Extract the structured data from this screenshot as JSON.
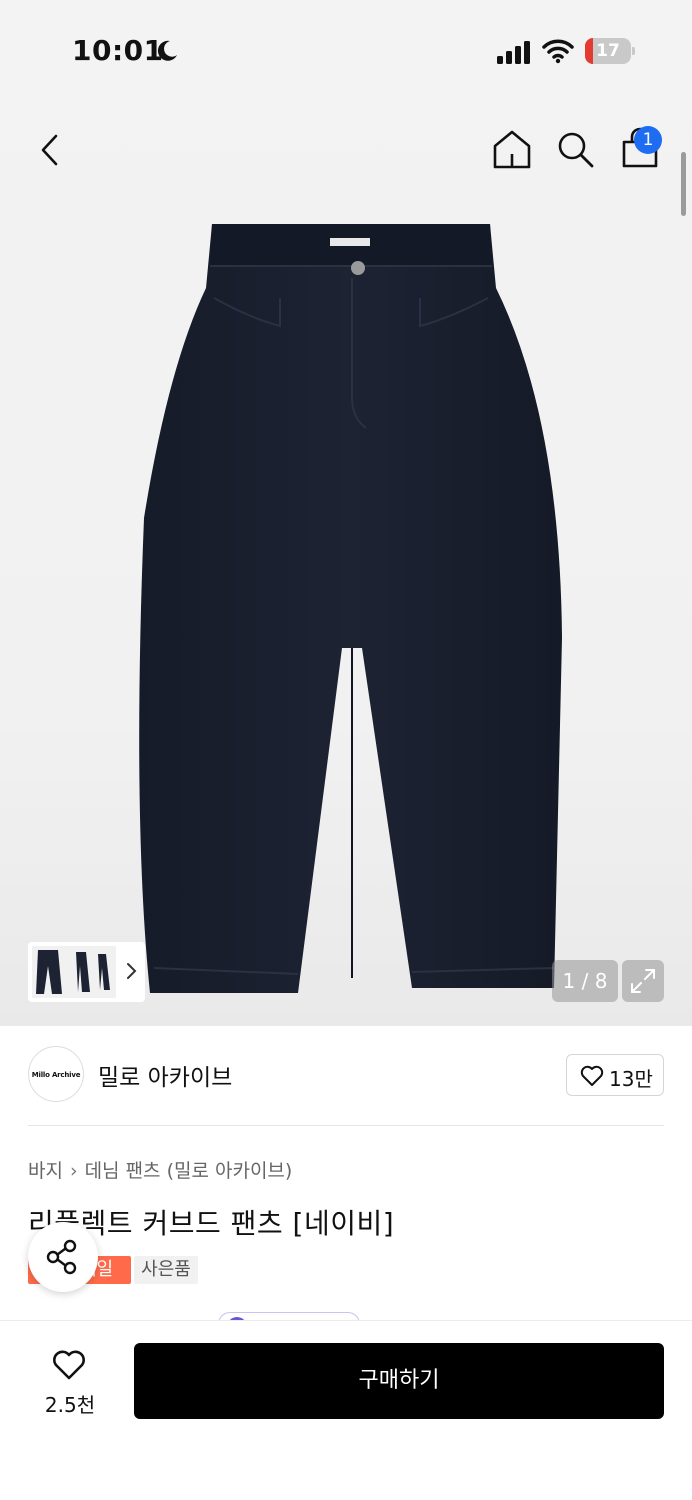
{
  "status_bar": {
    "time": "10:01",
    "battery": "17",
    "battery_level_percent": 17
  },
  "nav": {
    "cart_count": "1"
  },
  "gallery": {
    "counter": "1 / 8"
  },
  "brand": {
    "logo_text": "Millo Archive",
    "name": "밀로 아카이브",
    "likes": "13만"
  },
  "breadcrumb": {
    "category": "바지",
    "subcategory": "데님 팬츠 (밀로 아카이브)"
  },
  "product": {
    "title": "리플렉트 커브드 팬츠 [네이비]"
  },
  "tags": {
    "sale": "세일",
    "gift": "사은품"
  },
  "bottom": {
    "wish_count": "2.5천",
    "buy_label": "구매하기"
  },
  "colors": {
    "accent_blue": "#1e6cf1",
    "sale_orange": "#ff6b4a",
    "pants_navy": "#1b2130"
  }
}
